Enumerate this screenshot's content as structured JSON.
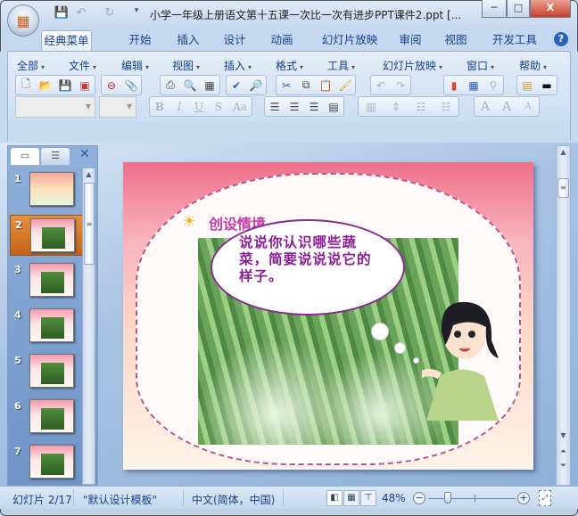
{
  "title_bar": {
    "doc_title": "小学一年级上册语文第十五课一次比一次有进步PPT课件2.ppt [...",
    "quick_access": [
      "save-icon",
      "undo-icon",
      "redo-icon",
      "customize-icon"
    ],
    "window_buttons": {
      "minimize": "─",
      "maximize": "□",
      "close": "X"
    }
  },
  "ribbon_tabs": [
    "经典菜单",
    "开始",
    "插入",
    "设计",
    "动画",
    "幻灯片放映",
    "审阅",
    "视图",
    "开发工具"
  ],
  "help_label": "?",
  "classic_menu": [
    "全部",
    "文件",
    "编辑",
    "视图",
    "插入",
    "格式",
    "工具",
    "幻灯片放映",
    "窗口",
    "帮助"
  ],
  "toolbar_row1": [
    "new-icon",
    "open-icon",
    "save-icon",
    "permission-icon",
    "delete-icon",
    "attach-icon",
    "print-icon",
    "print-preview-icon",
    "table-icon",
    "spelling-icon",
    "research-icon",
    "cut-icon",
    "copy-icon",
    "paste-icon",
    "format-painter-icon",
    "undo-icon",
    "redo-icon",
    "chart-icon",
    "insert-table-icon",
    "hyperlink-icon",
    "color-scheme-icon",
    "fill-color-icon"
  ],
  "toolbar_row2": {
    "font_labels": [
      "B",
      "I",
      "U",
      "S",
      "Aa"
    ],
    "align": [
      "align-left-icon",
      "align-center-icon",
      "align-right-icon",
      "justify-icon"
    ],
    "para": [
      "line-spacing-icon",
      "text-direction-icon",
      "numbering-icon",
      "bullets-icon"
    ],
    "size_labels": [
      "A",
      "A",
      "A"
    ]
  },
  "panel": {
    "tabs": [
      "slides-tab-icon",
      "outline-tab-icon"
    ],
    "close": "✕",
    "slides": [
      {
        "num": "1"
      },
      {
        "num": "2",
        "selected": true
      },
      {
        "num": "3"
      },
      {
        "num": "4"
      },
      {
        "num": "5"
      },
      {
        "num": "6"
      },
      {
        "num": "7"
      }
    ]
  },
  "slide": {
    "heading": "创设情境",
    "bubble_text": "说说你认识哪些蔬菜，简要说说说它的样子。"
  },
  "status_bar": {
    "slide_info": "幻灯片 2/17",
    "theme": "\"默认设计模板\"",
    "language": "中文(简体，中国)",
    "zoom": "48%",
    "zoom_fraction": 0.48
  }
}
